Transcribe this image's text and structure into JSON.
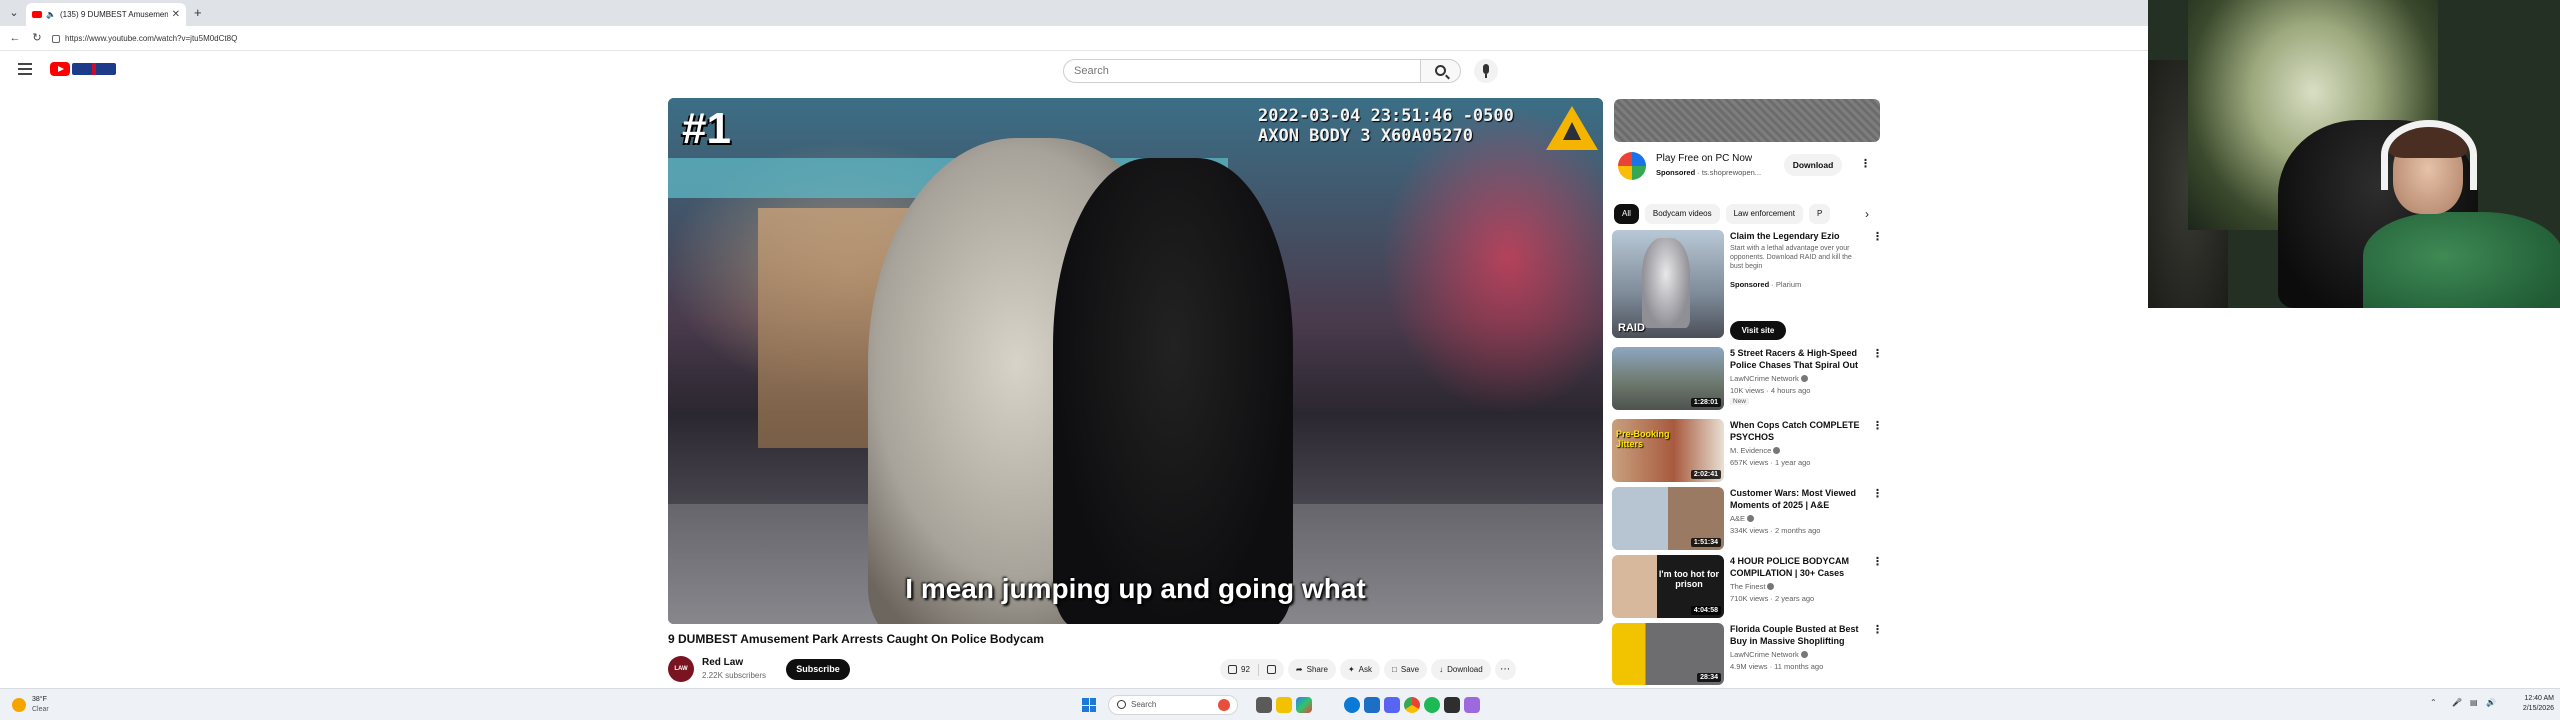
{
  "browser": {
    "tab_title": "(135) 9 DUMBEST Amusement...",
    "url": "https://www.youtube.com/watch?v=jtu5M0dCt8Q"
  },
  "header": {
    "search_placeholder": "Search"
  },
  "video": {
    "rank_overlay": "#1",
    "timestamp_line1": "2022-03-04 23:51:46 -0500",
    "timestamp_line2": "AXON BODY 3 X60A05270",
    "caption": "I mean jumping up and going what",
    "title": "9 DUMBEST Amusement Park Arrests Caught On Police Bodycam",
    "channel": {
      "name": "Red Law",
      "avatar_text": "LAW",
      "subscribers": "2.22K subscribers",
      "subscribe_label": "Subscribe"
    },
    "actions": {
      "like_count": "92",
      "share_label": "Share",
      "ask_label": "Ask",
      "save_label": "Save",
      "download_label": "Download"
    }
  },
  "sidebar": {
    "ad": {
      "title": "Play Free on PC Now",
      "sponsored": "Sponsored",
      "domain": "ts.shoprewopen...",
      "download_label": "Download"
    },
    "chips": [
      "All",
      "Bodycam videos",
      "Law enforcement",
      "P"
    ],
    "sponsored_video": {
      "title": "Claim the Legendary Ezio",
      "description": "Start with a lethal advantage over your opponents. Download RAID and kill the bust begin",
      "sponsored": "Sponsored",
      "advertiser": "Plarium",
      "thumb_text": "RAID",
      "cta": "Visit site"
    },
    "recommendations": [
      {
        "title": "5 Street Racers & High-Speed Police Chases That Spiral Out ...",
        "channel": "LawNCrime Network",
        "views": "10K views · 4 hours ago",
        "duration": "1:28:01",
        "badge": "New"
      },
      {
        "title": "When Cops Catch COMPLETE PSYCHOS",
        "channel": "M. Evidence",
        "views": "657K views · 1 year ago",
        "duration": "2:02:41",
        "thumb_text": "Pre-Booking Jitters"
      },
      {
        "title": "Customer Wars: Most Viewed Moments of 2025 | A&E",
        "channel": "A&E",
        "views": "334K views · 2 months ago",
        "duration": "1:51:34"
      },
      {
        "title": "4 HOUR POLICE BODYCAM COMPILATION | 30+ Cases Th...",
        "channel": "The Finest",
        "views": "710K views · 2 years ago",
        "duration": "4:04:58",
        "thumb_text": "I'm too hot for prison"
      },
      {
        "title": "Florida Couple Busted at Best Buy in Massive Shoplifting Ring",
        "channel": "LawNCrime Network",
        "views": "4.9M views · 11 months ago",
        "duration": "28:34"
      }
    ]
  },
  "taskbar": {
    "temperature": "38°F",
    "condition": "Clear",
    "search_placeholder": "Search",
    "time": "12:40 AM",
    "date": "2/15/2026"
  }
}
